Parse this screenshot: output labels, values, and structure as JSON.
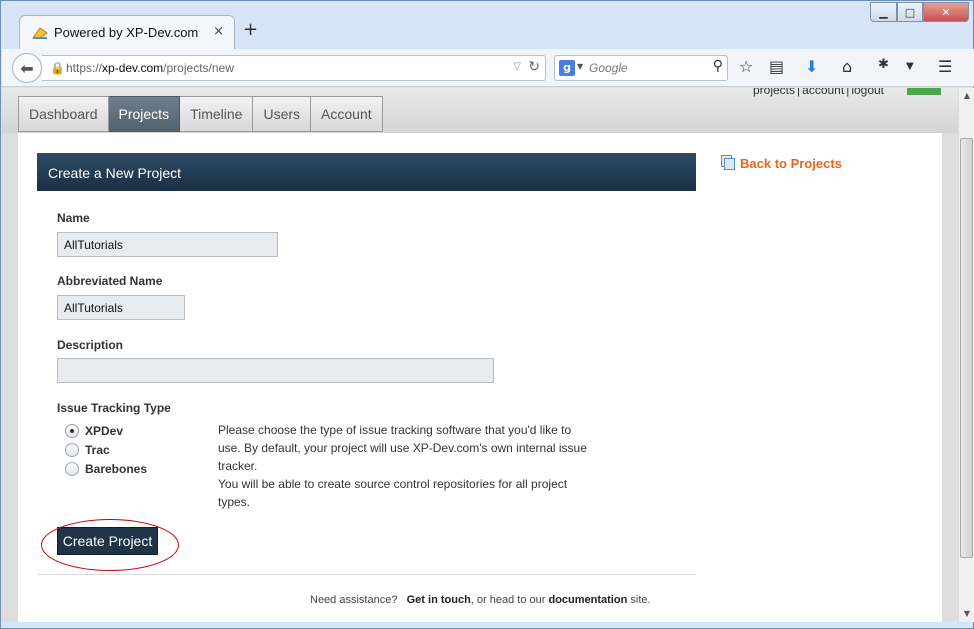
{
  "browser": {
    "tab_title": "Powered by XP-Dev.com",
    "tab_close": "×",
    "new_tab": "+",
    "url_prefix": "https://",
    "url_host": "xp-dev.com",
    "url_path": "/projects/new",
    "search_placeholder": "Google",
    "window_buttons": {
      "minimize": "▁",
      "maximize": "□",
      "close": "✕"
    }
  },
  "site": {
    "top_links": [
      "projects",
      "account",
      "logout"
    ],
    "nav_tabs": [
      {
        "label": "Dashboard",
        "active": false
      },
      {
        "label": "Projects",
        "active": true
      },
      {
        "label": "Timeline",
        "active": false
      },
      {
        "label": "Users",
        "active": false
      },
      {
        "label": "Account",
        "active": false
      }
    ],
    "back_link": "Back to Projects"
  },
  "form": {
    "heading": "Create a New Project",
    "name_label": "Name",
    "name_value": "AllTutorials",
    "abbr_label": "Abbreviated Name",
    "abbr_value": "AllTutorials",
    "description_label": "Description",
    "description_value": "",
    "tracking_label": "Issue Tracking Type",
    "tracking_options": [
      {
        "label": "XPDev",
        "checked": true
      },
      {
        "label": "Trac",
        "checked": false
      },
      {
        "label": "Barebones",
        "checked": false
      }
    ],
    "help_text_1": "Please choose the type of issue tracking software that you'd like to use. By default, your project will use XP-Dev.com's own internal issue tracker.",
    "help_text_2": "You will be able to create source control repositories for all project types.",
    "submit_label": "Create Project"
  },
  "footer": {
    "prefix": "Need assistance?",
    "link1": "Get in touch",
    "middle": ", or head to our",
    "link2": "documentation",
    "suffix": "site."
  },
  "colors": {
    "panel_header": "#1f3447",
    "active_tab": "#5e6e7c",
    "back_link": "#e6671d",
    "annotation": "#cc0000"
  }
}
